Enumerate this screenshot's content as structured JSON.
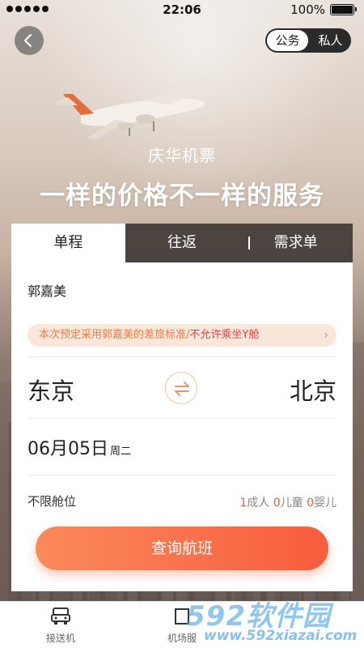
{
  "status_bar": {
    "time": "22:06",
    "battery": "100%"
  },
  "toggle": {
    "options": [
      "公务",
      "私人"
    ],
    "selected": "公务"
  },
  "hero": {
    "subtitle": "庆华机票",
    "headline": "一样的价格不一样的服务"
  },
  "tabs": [
    {
      "label": "单程",
      "active": true
    },
    {
      "label": "往返",
      "active": false
    },
    {
      "label": "需求单",
      "active": false
    }
  ],
  "form": {
    "traveler": "郭嘉美",
    "notice_part1": "本次预定采用郭嘉美的差旅标准/",
    "notice_part2": "不允许乘坐Y舱",
    "from_city": "东京",
    "to_city": "北京",
    "date": "06月05日",
    "weekday": "周二",
    "cabin": "不限舱位",
    "adults_count": "1",
    "adults_label": "成人",
    "children_count": "0",
    "children_label": "儿童",
    "infants_count": "0",
    "infants_label": "婴儿",
    "search_button": "查询航班"
  },
  "bottom_nav": [
    {
      "label": "接送机",
      "icon": "car-icon"
    },
    {
      "label": "机场服",
      "icon": "airport-icon"
    }
  ],
  "watermark": {
    "main": "592软件园",
    "url": "www.592xiazai.com"
  },
  "colors": {
    "accent": "#f75c3c",
    "accent_light": "#fb8a5b",
    "notice_bg": "#fbe7da",
    "notice_text": "#e47d4a",
    "warn_text": "#e0403b"
  }
}
